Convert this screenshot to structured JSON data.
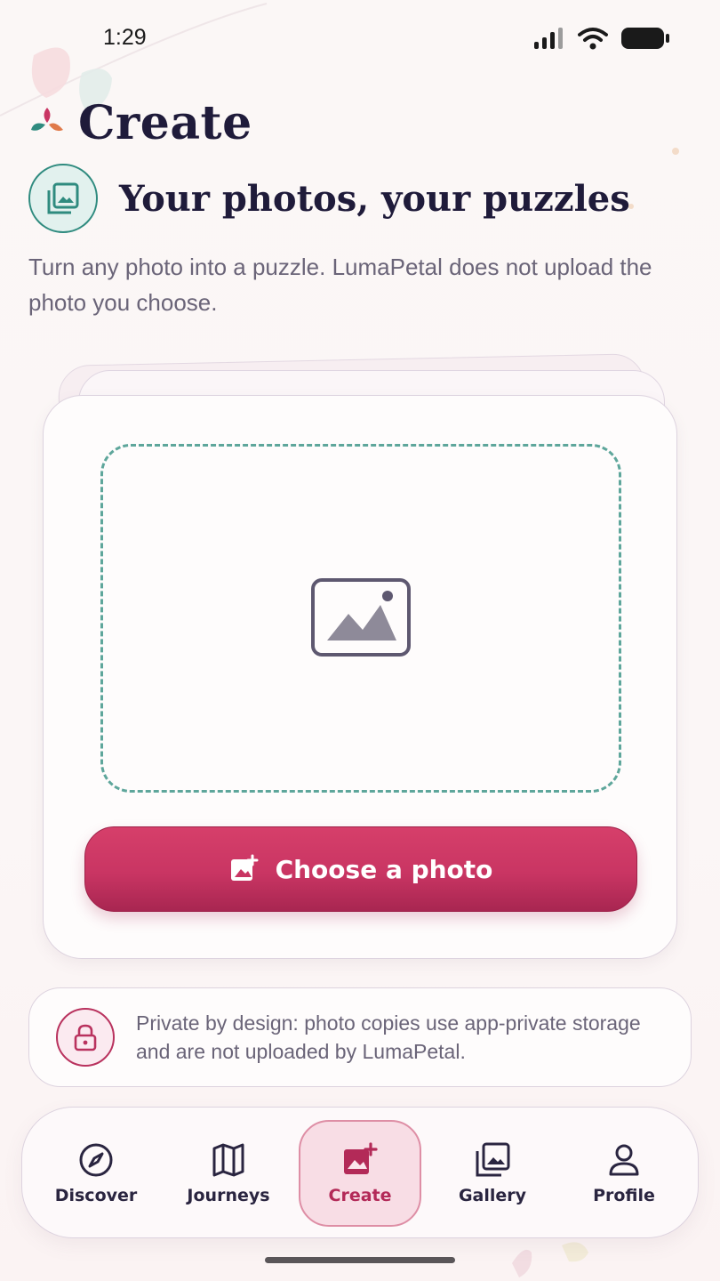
{
  "status_bar": {
    "time": "1:29",
    "signal_icon": "cell-signal-icon",
    "wifi_icon": "wifi-icon",
    "battery_icon": "battery-icon"
  },
  "header": {
    "title": "Create",
    "logo_icon": "petal-logo-icon"
  },
  "section": {
    "title": "Your photos, your puzzles",
    "icon": "photo-library-icon"
  },
  "subtitle": "Turn any photo into a puzzle. LumaPetal does not upload the photo you choose.",
  "drop_zone": {
    "icon": "image-placeholder-icon"
  },
  "choose_button": {
    "label": "Choose a photo",
    "icon": "add-photo-icon"
  },
  "privacy": {
    "text": "Private by design: photo copies use app-private storage and are not uploaded by LumaPetal.",
    "icon": "lock-icon"
  },
  "nav": {
    "items": [
      {
        "label": "Discover",
        "icon": "compass-icon",
        "active": false
      },
      {
        "label": "Journeys",
        "icon": "map-icon",
        "active": false
      },
      {
        "label": "Create",
        "icon": "add-photo-icon",
        "active": true
      },
      {
        "label": "Gallery",
        "icon": "gallery-icon",
        "active": false
      },
      {
        "label": "Profile",
        "icon": "person-icon",
        "active": false
      }
    ]
  },
  "colors": {
    "accent": "#c93563",
    "teal": "#2f8b7f",
    "ink": "#1f1b3a",
    "muted": "#6a6478"
  }
}
